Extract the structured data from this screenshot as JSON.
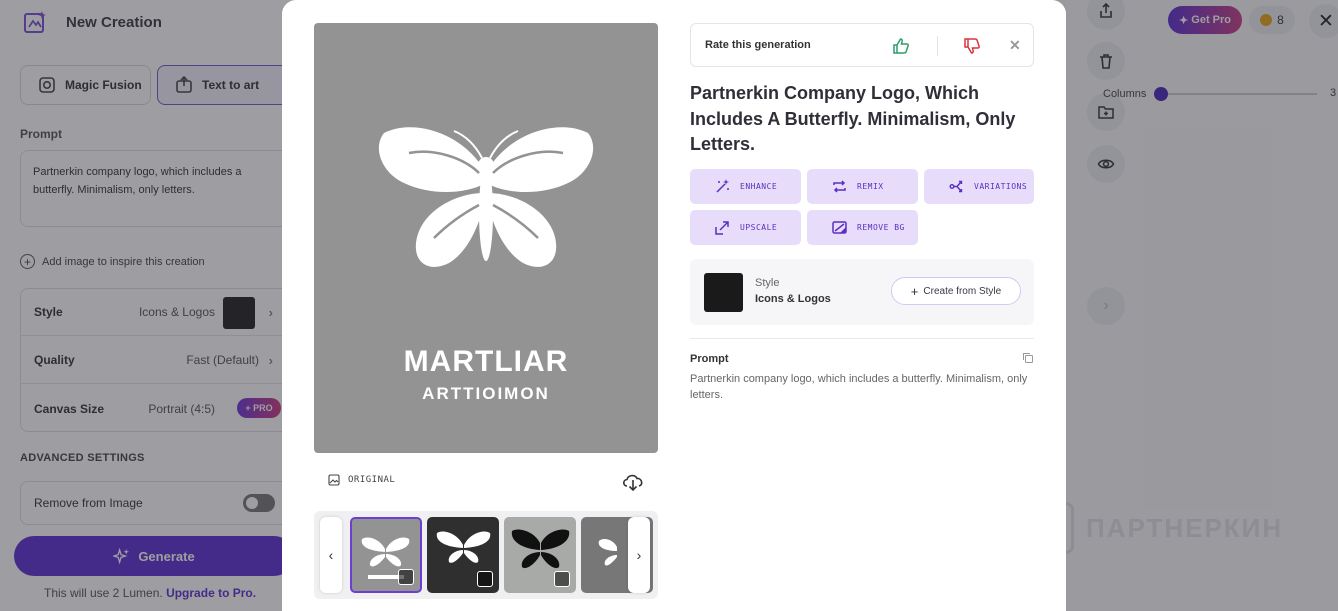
{
  "app": {
    "title": "New Creation",
    "modes": [
      {
        "label": "Magic Fusion",
        "icon": "magic-fusion-icon"
      },
      {
        "label": "Text to art",
        "icon": "text-to-art-icon"
      }
    ]
  },
  "form": {
    "prompt_label": "Prompt",
    "prompt_value": "Partnerkin company logo, which includes a butterfly. Minimalism, only letters.",
    "add_image": "Add image to inspire this creation",
    "settings": [
      {
        "label": "Style",
        "value": "Icons & Logos"
      },
      {
        "label": "Quality",
        "value": "Fast (Default)"
      },
      {
        "label": "Canvas Size",
        "value": "Portrait (4:5)",
        "badge": "+ PRO"
      }
    ],
    "advanced": "ADVANCED SETTINGS",
    "remove_label": "Remove from Image",
    "generate": "Generate",
    "lumen_text": "This will use 2 Lumen.",
    "upgrade": "Upgrade to Pro."
  },
  "header": {
    "get_pro": "Get Pro",
    "tokens": "8",
    "columns_label": "Columns",
    "columns_value": "3"
  },
  "watermark": "ПАРТНЕРКИН",
  "modal": {
    "logo_text": "MARTLIAR",
    "logo_subtext": "ARTTIOIMON",
    "original_label": "ORIGINAL",
    "rate_label": "Rate this generation",
    "title": "Partnerkin Company Logo, Which Includes A Butterfly. Minimalism, Only Letters.",
    "actions": [
      {
        "label": "ENHANCE",
        "icon": "enhance-icon"
      },
      {
        "label": "REMIX",
        "icon": "remix-icon"
      },
      {
        "label": "VARIATIONS",
        "icon": "variations-icon"
      },
      {
        "label": "UPSCALE",
        "icon": "upscale-icon"
      },
      {
        "label": "REMOVE BG",
        "icon": "remove-bg-icon"
      }
    ],
    "style_label": "Style",
    "style_value": "Icons & Logos",
    "create_from_style": "Create from Style",
    "prompt_label": "Prompt",
    "prompt_text": "Partnerkin company logo, which includes a butterfly. Minimalism, only letters."
  },
  "colors": {
    "accent": "#5b2fd1",
    "action_bg": "#e7ddfa",
    "thumbs_up": "#2e9e6a",
    "thumbs_down": "#d9343a"
  }
}
